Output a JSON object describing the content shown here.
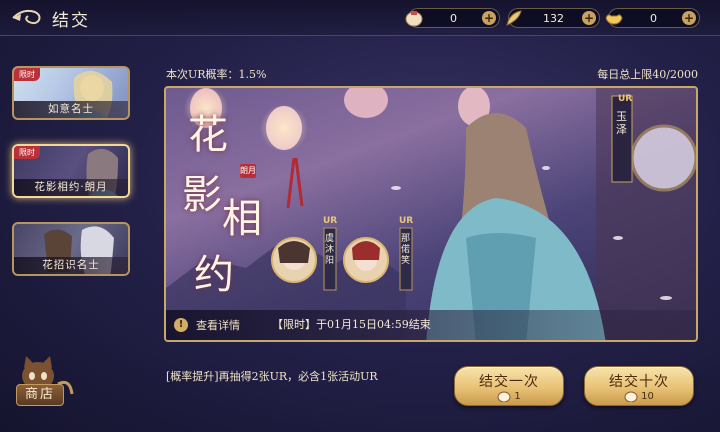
{
  "header": {
    "title": "结交",
    "currencies": [
      {
        "icon": "coin-bag-icon",
        "value": "0"
      },
      {
        "icon": "feather-icon",
        "value": "132"
      },
      {
        "icon": "gold-ingot-icon",
        "value": "0"
      }
    ]
  },
  "pools": [
    {
      "tag": "限时",
      "name": "如意名士"
    },
    {
      "tag": "限时",
      "name": "花影相约·朗月"
    },
    {
      "tag": "",
      "name": "花招识名士"
    }
  ],
  "info": {
    "ur_rate": "本次UR概率：1.5%",
    "daily_limit": "每日总上限40/2000"
  },
  "banner": {
    "title_chars": [
      "花",
      "影",
      "相",
      "约"
    ],
    "seal_text": "朗月",
    "featured_name": "玉泽",
    "ur_badge": "UR",
    "side_characters": [
      {
        "name": "虞沐阳",
        "badge": "UR"
      },
      {
        "name": "那偌笑",
        "badge": "UR"
      }
    ],
    "details_label": "查看详情",
    "timer_text": "【限时】于01月15日04:59结束"
  },
  "footer": {
    "promo_text": "[概率提升]再抽得2张UR，必含1张活动UR",
    "shop_label": "商店",
    "draw_one": {
      "label": "结交一次",
      "cost": "1"
    },
    "draw_ten": {
      "label": "结交十次",
      "cost": "10"
    }
  },
  "colors": {
    "accent_gold": "#c8a868",
    "tag_red": "#b9323a",
    "background": "#24214a"
  }
}
